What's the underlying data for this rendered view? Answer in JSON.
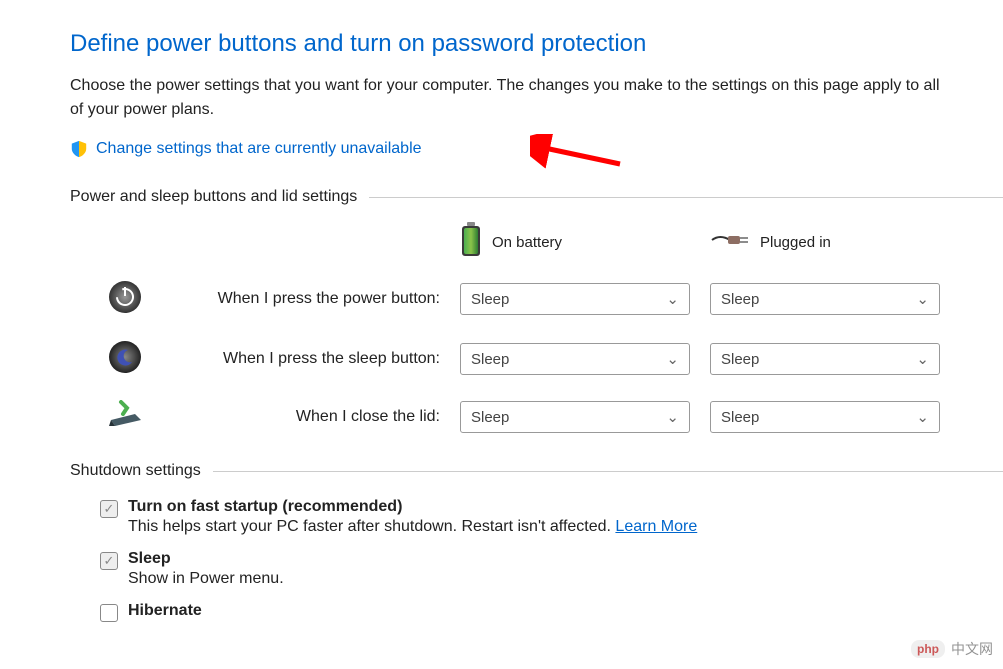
{
  "title": "Define power buttons and turn on password protection",
  "description": "Choose the power settings that you want for your computer. The changes you make to the settings on this page apply to all of your power plans.",
  "change_link": "Change settings that are currently unavailable",
  "section_power": {
    "header": "Power and sleep buttons and lid settings",
    "columns": {
      "battery": "On battery",
      "plugged": "Plugged in"
    },
    "rows": [
      {
        "label": "When I press the power button:",
        "battery_value": "Sleep",
        "plugged_value": "Sleep"
      },
      {
        "label": "When I press the sleep button:",
        "battery_value": "Sleep",
        "plugged_value": "Sleep"
      },
      {
        "label": "When I close the lid:",
        "battery_value": "Sleep",
        "plugged_value": "Sleep"
      }
    ]
  },
  "section_shutdown": {
    "header": "Shutdown settings",
    "items": [
      {
        "title": "Turn on fast startup (recommended)",
        "desc": "This helps start your PC faster after shutdown. Restart isn't affected. ",
        "learn_more": "Learn More",
        "checked": true
      },
      {
        "title": "Sleep",
        "desc": "Show in Power menu.",
        "checked": true
      },
      {
        "title": "Hibernate",
        "desc": "",
        "checked": false
      }
    ]
  },
  "watermark": "中文网"
}
